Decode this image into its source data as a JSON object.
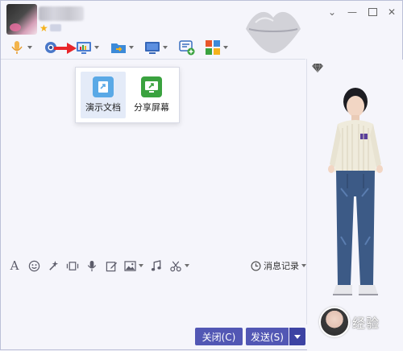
{
  "popup": {
    "items": [
      {
        "label": "演示文档",
        "icon": "presentation-document-icon",
        "color": "#5aa9e6"
      },
      {
        "label": "分享屏幕",
        "icon": "share-screen-icon",
        "color": "#3aa23f"
      }
    ]
  },
  "input_toolbar": {
    "msg_log_label": "消息记录"
  },
  "footer": {
    "close_label": "关闭(C)",
    "send_label": "发送(S)"
  },
  "watermark": "经验",
  "colors": {
    "accent": "#5257b4",
    "star": "#f5b21b",
    "red_arrow": "#e8262a"
  }
}
